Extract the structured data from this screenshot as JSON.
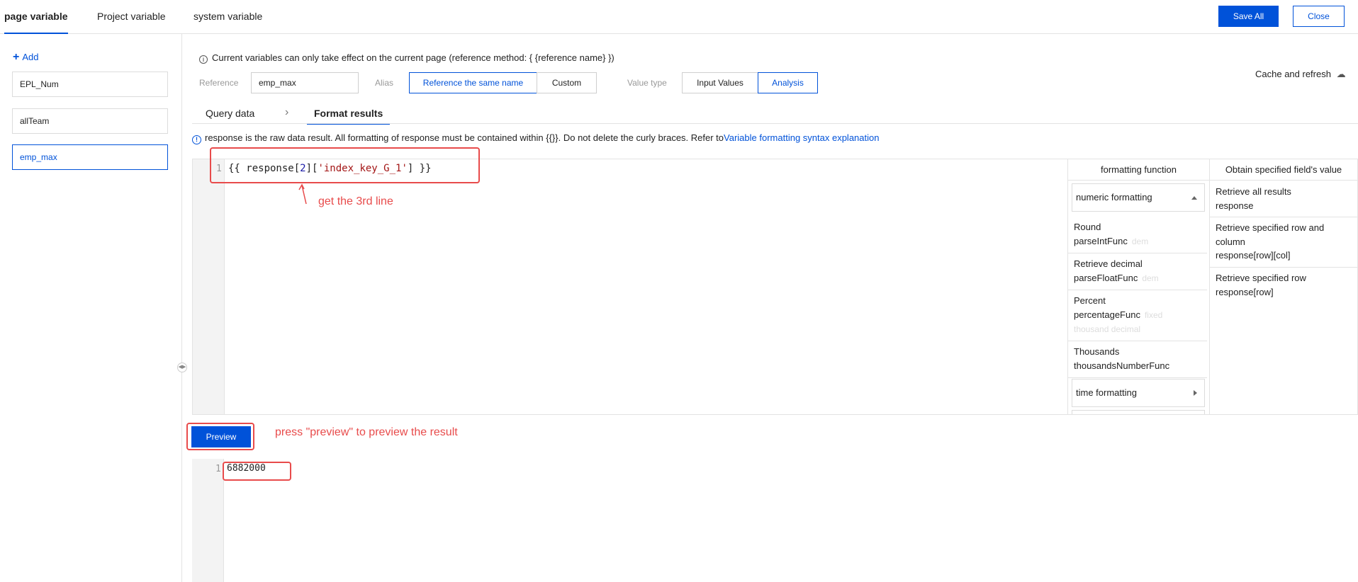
{
  "top_tabs": [
    "page variable",
    "Project variable",
    "system variable"
  ],
  "active_top_tab": "page variable",
  "actions": {
    "save_all": "Save All",
    "close": "Close"
  },
  "sidebar": {
    "add_label": "Add",
    "items": [
      "EPL_Num",
      "allTeam",
      "emp_max"
    ],
    "active_item": "emp_max"
  },
  "notice": "Current variables can only take effect on the current page (reference method: { {reference name} })",
  "form": {
    "reference_label": "Reference",
    "reference_value": "emp_max",
    "alias_label": "Alias",
    "alias_options": [
      "Reference the same name",
      "Custom"
    ],
    "alias_selected": "Reference the same name",
    "value_type_label": "Value type",
    "value_type_options": [
      "Input Values",
      "Analysis"
    ],
    "value_type_selected": "Analysis",
    "cache_refresh": "Cache and refresh"
  },
  "sub_tabs": [
    "Query data",
    "Format results"
  ],
  "active_sub_tab": "Format results",
  "hint": {
    "text": "response is the raw data result. All formatting of response must be contained within {{}}. Do not delete the curly braces. Refer to",
    "link": "Variable formatting syntax explanation"
  },
  "editor": {
    "line_number": "1",
    "code_prefix": "{{ response[",
    "code_index": "2",
    "code_mid": "][",
    "code_key": "'index_key_G_1'",
    "code_suffix": "] }}"
  },
  "formatting_panel": {
    "title": "formatting function",
    "group_numeric": "numeric formatting",
    "functions": [
      {
        "name": "Round",
        "func": "parseIntFunc",
        "hint": "dem"
      },
      {
        "name": "Retrieve decimal",
        "func": "parseFloatFunc",
        "hint": "dem"
      },
      {
        "name": "Percent",
        "func": "percentageFunc",
        "hint": "fixed",
        "hint2": "thousand decimal"
      },
      {
        "name": "Thousands",
        "func": "thousandsNumberFunc",
        "hint": ""
      }
    ],
    "group_time": "time formatting"
  },
  "field_panel": {
    "title": "Obtain specified field's value",
    "items": [
      {
        "label": "Retrieve all results",
        "code": "response"
      },
      {
        "label": "Retrieve specified row and column",
        "code": "response[row][col]"
      },
      {
        "label": "Retrieve specified row",
        "code": "response[row]"
      }
    ]
  },
  "preview_button": "Preview",
  "result": {
    "line_number": "1",
    "value": "6882000"
  },
  "annotations": {
    "third_line": "get the 3rd line",
    "preview": "press \"preview\" to preview the result"
  },
  "colors": {
    "accent": "#0052d9",
    "annotation": "#e84b4b"
  }
}
